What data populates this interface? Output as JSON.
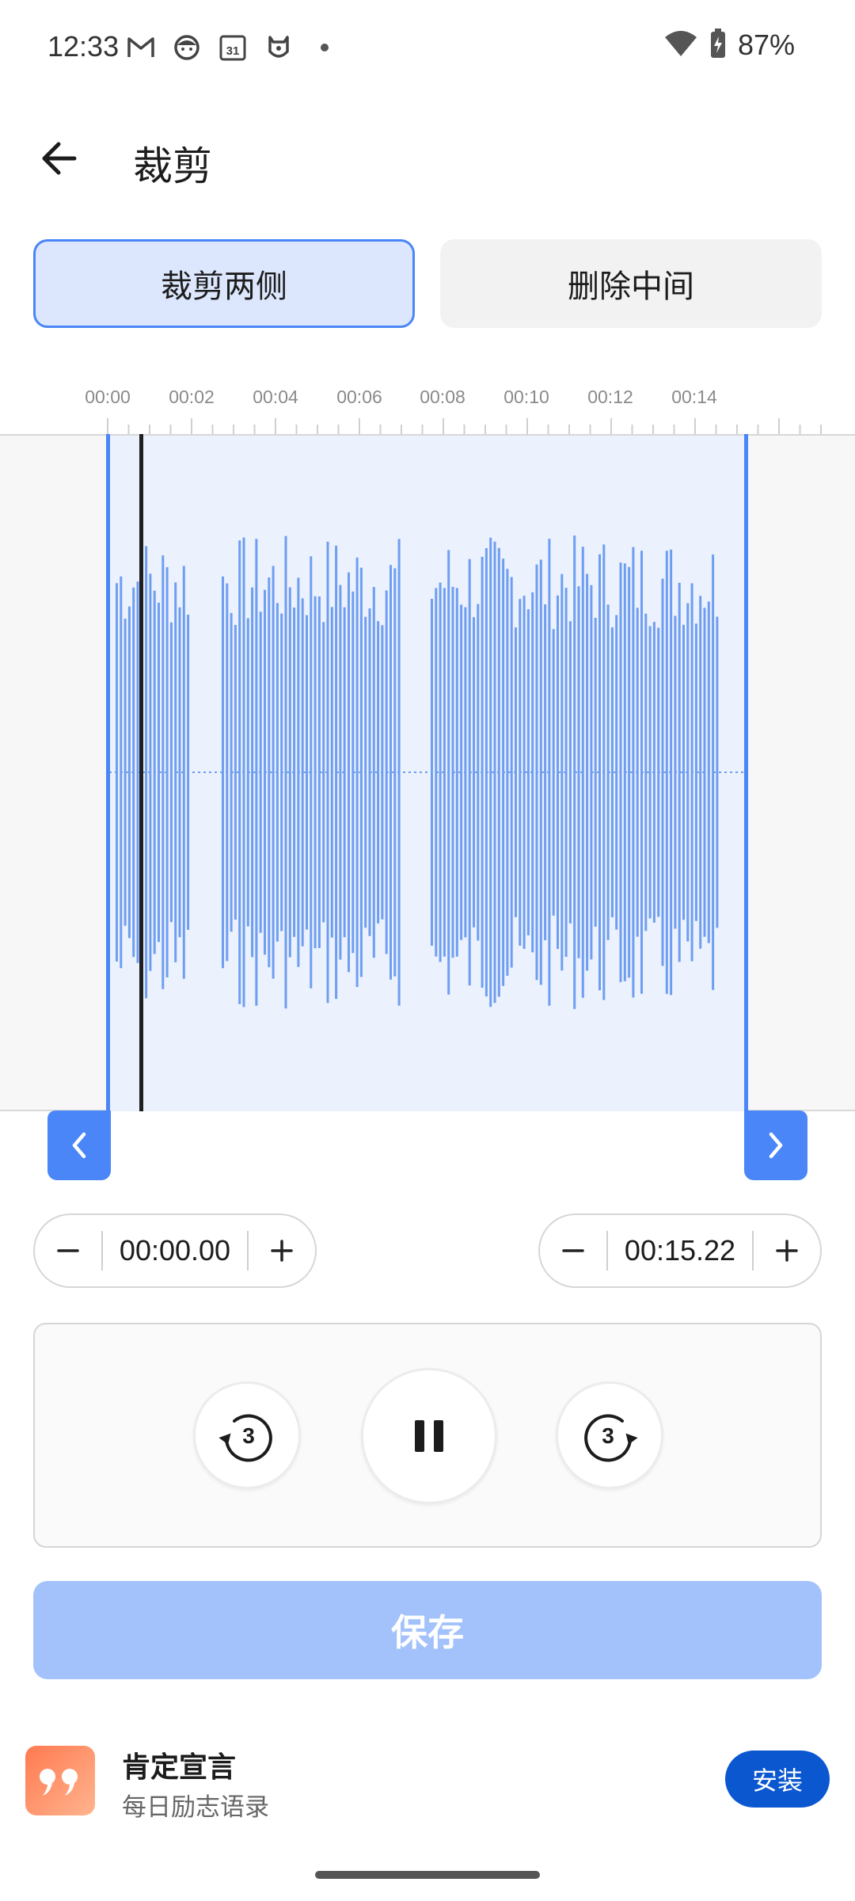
{
  "status_bar": {
    "time": "12:33",
    "battery": "87%",
    "icons": [
      "gmail-icon",
      "app-face-icon",
      "calendar-icon",
      "xiaomi-icon",
      "dot-icon",
      "wifi-icon",
      "battery-charging-icon"
    ],
    "calendar_day": "31"
  },
  "header": {
    "title": "裁剪",
    "back_icon": "arrow-left-icon"
  },
  "tabs": {
    "trim_sides": "裁剪两侧",
    "delete_middle": "删除中间",
    "selected": "trim_sides"
  },
  "timeline": {
    "ticks": [
      "00:00",
      "00:02",
      "00:04",
      "00:06",
      "00:08",
      "00:10",
      "00:12",
      "00:14"
    ],
    "selection_start_s": 0.0,
    "selection_end_s": 15.22,
    "playhead_s": 0.8,
    "colors": {
      "accent": "#4a86f7",
      "wave": "#6f9ef0",
      "selection": "#ebf1fd"
    }
  },
  "start_stepper": {
    "value": "00:00.00",
    "minus": "−",
    "plus": "+"
  },
  "end_stepper": {
    "value": "00:15.22",
    "minus": "−",
    "plus": "+"
  },
  "playback": {
    "rewind_seconds": "3",
    "forward_seconds": "3",
    "state": "playing"
  },
  "save_label": "保存",
  "ad": {
    "title": "肯定宣言",
    "subtitle": "每日励志语录",
    "install": "安装"
  }
}
